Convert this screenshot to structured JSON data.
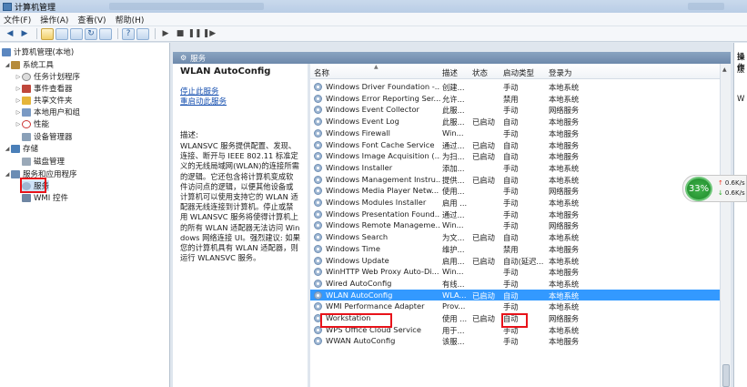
{
  "window": {
    "title": "计算机管理"
  },
  "menu": [
    "文件(F)",
    "操作(A)",
    "查看(V)",
    "帮助(H)"
  ],
  "tree": {
    "root": "计算机管理(本地)",
    "system_tools": "系统工具",
    "task_scheduler": "任务计划程序",
    "event_viewer": "事件查看器",
    "shared_folders": "共享文件夹",
    "local_users": "本地用户和组",
    "performance": "性能",
    "device_manager": "设备管理器",
    "storage": "存储",
    "disk_management": "磁盘管理",
    "services_apps": "服务和应用程序",
    "services": "服务",
    "wmi": "WMI 控件"
  },
  "panel": {
    "header": "服务",
    "service_name": "WLAN AutoConfig",
    "stop_link": "停止此服务",
    "restart_link": "重启动此服务",
    "desc_label": "描述:",
    "desc_text": "WLANSVC 服务提供配置、发现、连接、断开与 IEEE 802.11 标准定义的无线局域网(WLAN)的连接所需的逻辑。它还包含将计算机变成软件访问点的逻辑，以便其他设备或计算机可以使用支持它的 WLAN 适配器无线连接到计算机。停止或禁用 WLANSVC 服务将使得计算机上的所有 WLAN 适配器无法访问 Windows 网络连接 UI。强烈建议: 如果您的计算机具有 WLAN 适配器，则运行 WLANSVC 服务。"
  },
  "columns": [
    "名称",
    "描述",
    "状态",
    "启动类型",
    "登录为"
  ],
  "services": [
    {
      "name": "Windows Driver Foundation -...",
      "desc": "创建...",
      "status": "",
      "startup": "手动",
      "logon": "本地系统"
    },
    {
      "name": "Windows Error Reporting Ser...",
      "desc": "允许...",
      "status": "",
      "startup": "禁用",
      "logon": "本地系统"
    },
    {
      "name": "Windows Event Collector",
      "desc": "此服...",
      "status": "",
      "startup": "手动",
      "logon": "网络服务"
    },
    {
      "name": "Windows Event Log",
      "desc": "此服...",
      "status": "已启动",
      "startup": "自动",
      "logon": "本地服务"
    },
    {
      "name": "Windows Firewall",
      "desc": "Win...",
      "status": "",
      "startup": "手动",
      "logon": "本地服务"
    },
    {
      "name": "Windows Font Cache Service",
      "desc": "通过...",
      "status": "已启动",
      "startup": "自动",
      "logon": "本地服务"
    },
    {
      "name": "Windows Image Acquisition (...",
      "desc": "为扫...",
      "status": "已启动",
      "startup": "自动",
      "logon": "本地服务"
    },
    {
      "name": "Windows Installer",
      "desc": "添加...",
      "status": "",
      "startup": "手动",
      "logon": "本地系统"
    },
    {
      "name": "Windows Management Instru...",
      "desc": "提供...",
      "status": "已启动",
      "startup": "自动",
      "logon": "本地系统"
    },
    {
      "name": "Windows Media Player Netw...",
      "desc": "使用...",
      "status": "",
      "startup": "手动",
      "logon": "网络服务"
    },
    {
      "name": "Windows Modules Installer",
      "desc": "启用 ...",
      "status": "",
      "startup": "手动",
      "logon": "本地系统"
    },
    {
      "name": "Windows Presentation Found...",
      "desc": "通过...",
      "status": "",
      "startup": "手动",
      "logon": "本地服务"
    },
    {
      "name": "Windows Remote Manageme...",
      "desc": "Win...",
      "status": "",
      "startup": "手动",
      "logon": "网络服务"
    },
    {
      "name": "Windows Search",
      "desc": "为文...",
      "status": "已启动",
      "startup": "自动",
      "logon": "本地系统"
    },
    {
      "name": "Windows Time",
      "desc": "维护...",
      "status": "",
      "startup": "禁用",
      "logon": "本地服务"
    },
    {
      "name": "Windows Update",
      "desc": "启用...",
      "status": "已启动",
      "startup": "自动(延迟...",
      "logon": "本地系统"
    },
    {
      "name": "WinHTTP Web Proxy Auto-Di...",
      "desc": "Win...",
      "status": "",
      "startup": "手动",
      "logon": "本地服务"
    },
    {
      "name": "Wired AutoConfig",
      "desc": "有线...",
      "status": "",
      "startup": "手动",
      "logon": "本地系统"
    },
    {
      "name": "WLAN AutoConfig",
      "desc": "WLA...",
      "status": "已启动",
      "startup": "自动",
      "logon": "本地系统",
      "selected": true
    },
    {
      "name": "WMI Performance Adapter",
      "desc": "Prov...",
      "status": "",
      "startup": "手动",
      "logon": "本地系统"
    },
    {
      "name": "Workstation",
      "desc": "使用 ...",
      "status": "已启动",
      "startup": "自动",
      "logon": "网络服务"
    },
    {
      "name": "WPS Office Cloud Service",
      "desc": "用于...",
      "status": "",
      "startup": "手动",
      "logon": "本地系统"
    },
    {
      "name": "WWAN AutoConfig",
      "desc": "该服...",
      "status": "",
      "startup": "手动",
      "logon": "本地服务"
    }
  ],
  "actions": {
    "header": "操作",
    "item1": "服",
    "item2": "W"
  },
  "speed": {
    "percent": "33%",
    "upload": "0.6K/s",
    "download": "0.6K/s"
  },
  "colors": {
    "selection": "#3399ff",
    "highlight_box": "#e8131a",
    "panel_header": "#7a95b6"
  }
}
